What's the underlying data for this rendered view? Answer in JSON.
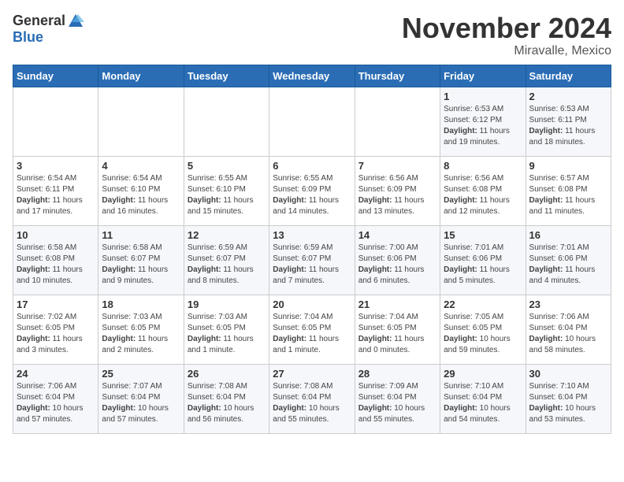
{
  "header": {
    "logo_general": "General",
    "logo_blue": "Blue",
    "month_title": "November 2024",
    "location": "Miravalle, Mexico"
  },
  "weekdays": [
    "Sunday",
    "Monday",
    "Tuesday",
    "Wednesday",
    "Thursday",
    "Friday",
    "Saturday"
  ],
  "weeks": [
    [
      {
        "day": "",
        "info": ""
      },
      {
        "day": "",
        "info": ""
      },
      {
        "day": "",
        "info": ""
      },
      {
        "day": "",
        "info": ""
      },
      {
        "day": "",
        "info": ""
      },
      {
        "day": "1",
        "info": "Sunrise: 6:53 AM\nSunset: 6:12 PM\nDaylight: 11 hours and 19 minutes."
      },
      {
        "day": "2",
        "info": "Sunrise: 6:53 AM\nSunset: 6:11 PM\nDaylight: 11 hours and 18 minutes."
      }
    ],
    [
      {
        "day": "3",
        "info": "Sunrise: 6:54 AM\nSunset: 6:11 PM\nDaylight: 11 hours and 17 minutes."
      },
      {
        "day": "4",
        "info": "Sunrise: 6:54 AM\nSunset: 6:10 PM\nDaylight: 11 hours and 16 minutes."
      },
      {
        "day": "5",
        "info": "Sunrise: 6:55 AM\nSunset: 6:10 PM\nDaylight: 11 hours and 15 minutes."
      },
      {
        "day": "6",
        "info": "Sunrise: 6:55 AM\nSunset: 6:09 PM\nDaylight: 11 hours and 14 minutes."
      },
      {
        "day": "7",
        "info": "Sunrise: 6:56 AM\nSunset: 6:09 PM\nDaylight: 11 hours and 13 minutes."
      },
      {
        "day": "8",
        "info": "Sunrise: 6:56 AM\nSunset: 6:08 PM\nDaylight: 11 hours and 12 minutes."
      },
      {
        "day": "9",
        "info": "Sunrise: 6:57 AM\nSunset: 6:08 PM\nDaylight: 11 hours and 11 minutes."
      }
    ],
    [
      {
        "day": "10",
        "info": "Sunrise: 6:58 AM\nSunset: 6:08 PM\nDaylight: 11 hours and 10 minutes."
      },
      {
        "day": "11",
        "info": "Sunrise: 6:58 AM\nSunset: 6:07 PM\nDaylight: 11 hours and 9 minutes."
      },
      {
        "day": "12",
        "info": "Sunrise: 6:59 AM\nSunset: 6:07 PM\nDaylight: 11 hours and 8 minutes."
      },
      {
        "day": "13",
        "info": "Sunrise: 6:59 AM\nSunset: 6:07 PM\nDaylight: 11 hours and 7 minutes."
      },
      {
        "day": "14",
        "info": "Sunrise: 7:00 AM\nSunset: 6:06 PM\nDaylight: 11 hours and 6 minutes."
      },
      {
        "day": "15",
        "info": "Sunrise: 7:01 AM\nSunset: 6:06 PM\nDaylight: 11 hours and 5 minutes."
      },
      {
        "day": "16",
        "info": "Sunrise: 7:01 AM\nSunset: 6:06 PM\nDaylight: 11 hours and 4 minutes."
      }
    ],
    [
      {
        "day": "17",
        "info": "Sunrise: 7:02 AM\nSunset: 6:05 PM\nDaylight: 11 hours and 3 minutes."
      },
      {
        "day": "18",
        "info": "Sunrise: 7:03 AM\nSunset: 6:05 PM\nDaylight: 11 hours and 2 minutes."
      },
      {
        "day": "19",
        "info": "Sunrise: 7:03 AM\nSunset: 6:05 PM\nDaylight: 11 hours and 1 minute."
      },
      {
        "day": "20",
        "info": "Sunrise: 7:04 AM\nSunset: 6:05 PM\nDaylight: 11 hours and 1 minute."
      },
      {
        "day": "21",
        "info": "Sunrise: 7:04 AM\nSunset: 6:05 PM\nDaylight: 11 hours and 0 minutes."
      },
      {
        "day": "22",
        "info": "Sunrise: 7:05 AM\nSunset: 6:05 PM\nDaylight: 10 hours and 59 minutes."
      },
      {
        "day": "23",
        "info": "Sunrise: 7:06 AM\nSunset: 6:04 PM\nDaylight: 10 hours and 58 minutes."
      }
    ],
    [
      {
        "day": "24",
        "info": "Sunrise: 7:06 AM\nSunset: 6:04 PM\nDaylight: 10 hours and 57 minutes."
      },
      {
        "day": "25",
        "info": "Sunrise: 7:07 AM\nSunset: 6:04 PM\nDaylight: 10 hours and 57 minutes."
      },
      {
        "day": "26",
        "info": "Sunrise: 7:08 AM\nSunset: 6:04 PM\nDaylight: 10 hours and 56 minutes."
      },
      {
        "day": "27",
        "info": "Sunrise: 7:08 AM\nSunset: 6:04 PM\nDaylight: 10 hours and 55 minutes."
      },
      {
        "day": "28",
        "info": "Sunrise: 7:09 AM\nSunset: 6:04 PM\nDaylight: 10 hours and 55 minutes."
      },
      {
        "day": "29",
        "info": "Sunrise: 7:10 AM\nSunset: 6:04 PM\nDaylight: 10 hours and 54 minutes."
      },
      {
        "day": "30",
        "info": "Sunrise: 7:10 AM\nSunset: 6:04 PM\nDaylight: 10 hours and 53 minutes."
      }
    ]
  ]
}
